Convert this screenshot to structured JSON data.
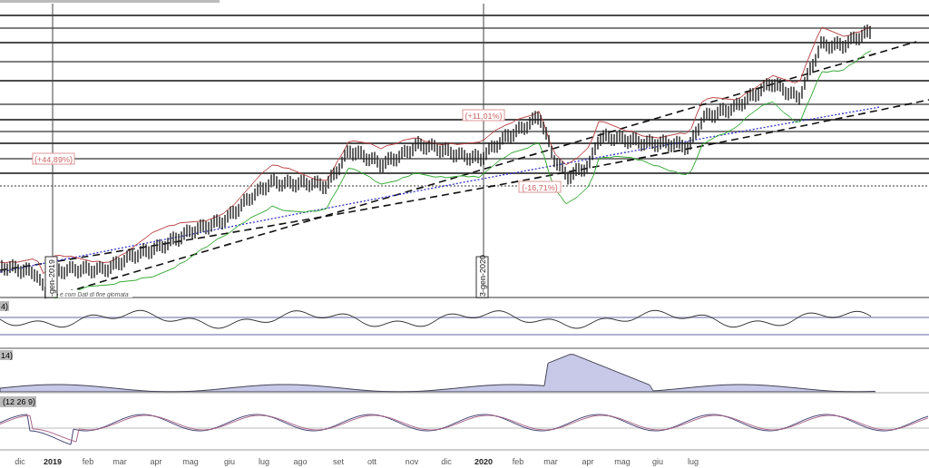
{
  "price_panel": {
    "source_note": "e.com  Dati di fine giornata",
    "percent_labels": [
      {
        "text": "(+44,89%)"
      },
      {
        "text": "(+11,01%)"
      },
      {
        "text": "(-16,71%)"
      }
    ],
    "date_markers": [
      "-gen-2019",
      "3-gen-2020"
    ]
  },
  "rsi_panel": {
    "label": "4)"
  },
  "adx_panel": {
    "label": "14)"
  },
  "macd_panel": {
    "label": "(12 26 9)"
  },
  "x_axis": {
    "labels": [
      {
        "text": "dic",
        "bold": false
      },
      {
        "text": "2019",
        "bold": true
      },
      {
        "text": "feb",
        "bold": false
      },
      {
        "text": "mar",
        "bold": false
      },
      {
        "text": "apr",
        "bold": false
      },
      {
        "text": "mag",
        "bold": false
      },
      {
        "text": "giu",
        "bold": false
      },
      {
        "text": "lug",
        "bold": false
      },
      {
        "text": "ago",
        "bold": false
      },
      {
        "text": "set",
        "bold": false
      },
      {
        "text": "ott",
        "bold": false
      },
      {
        "text": "nov",
        "bold": false
      },
      {
        "text": "dic",
        "bold": false
      },
      {
        "text": "2020",
        "bold": true
      },
      {
        "text": "feb",
        "bold": false
      },
      {
        "text": "mar",
        "bold": false
      },
      {
        "text": "apr",
        "bold": false
      },
      {
        "text": "mag",
        "bold": false
      },
      {
        "text": "giu",
        "bold": false
      },
      {
        "text": "lug",
        "bold": false
      }
    ]
  }
}
